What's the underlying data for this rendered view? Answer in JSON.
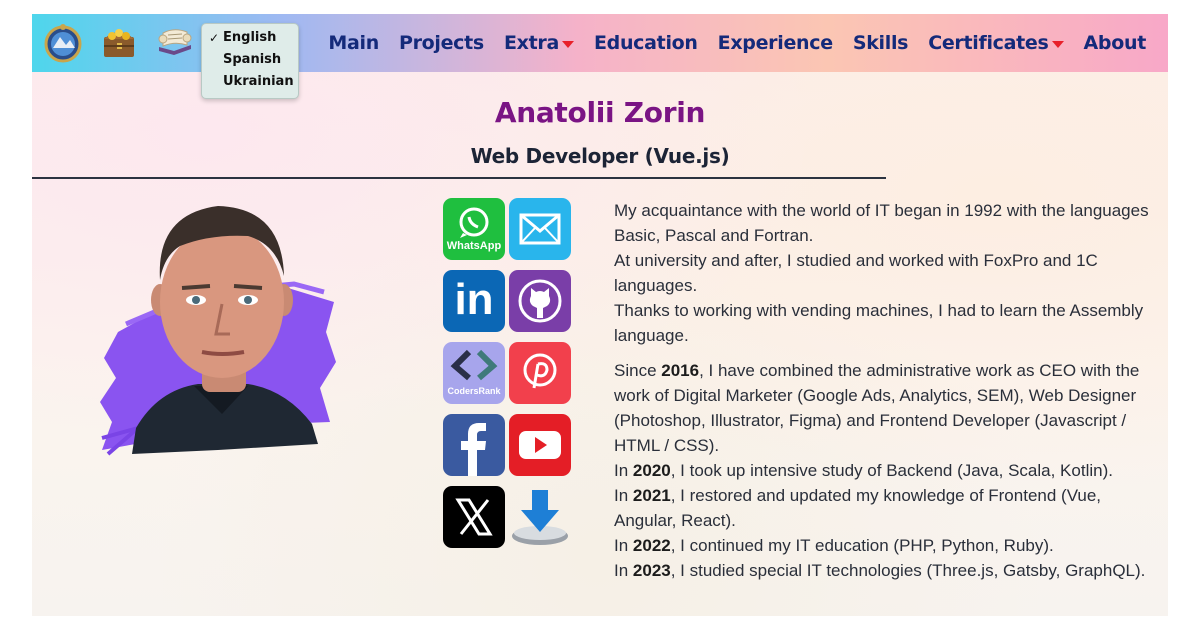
{
  "header": {
    "language_menu": {
      "selected_mark": "✓",
      "options": [
        "English",
        "Spanish",
        "Ukrainian"
      ]
    },
    "nav": {
      "main": "Main",
      "projects": "Projects",
      "extra": "Extra",
      "education": "Education",
      "experience": "Experience",
      "skills": "Skills",
      "certificates": "Certificates",
      "about": "About"
    }
  },
  "profile": {
    "name": "Anatolii Zorin",
    "role": "Web Developer (Vue.js)"
  },
  "social": {
    "whatsapp_label": "WhatsApp",
    "codersrank_label": "CodersRank",
    "linkedin_text": "in"
  },
  "bio": {
    "p1_l1": "My acquaintance with the world of IT began in 1992 with the languages Basic, Pascal and Fortran.",
    "p1_l2": "At university and after, I studied and worked with FoxPro and 1C languages.",
    "p1_l3": "Thanks to working with vending machines, I had to learn the Assembly language.",
    "y2016_pre": "Since ",
    "y2016": "2016",
    "y2016_post": ", I have combined the administrative work as CEO with the work of Digital Marketer (Google Ads, Analytics, SEM), Web Designer (Photoshop, Illustrator, Figma) and Frontend Developer (Javascript / HTML / CSS).",
    "in_word": "In ",
    "y2020": "2020",
    "y2020_post": ", I took up intensive study of Backend (Java, Scala, Kotlin).",
    "y2021": "2021",
    "y2021_post": ", I restored and updated my knowledge of Frontend (Vue, Angular, React).",
    "y2022": "2022",
    "y2022_post": ", I continued my IT education (PHP, Python, Ruby).",
    "y2023": "2023",
    "y2023_post": ", I studied special IT technologies (Three.js, Gatsby, GraphQL)."
  },
  "colors": {
    "name": "#7a1484",
    "nav_text": "#142a7a",
    "caret": "#e8202a"
  }
}
